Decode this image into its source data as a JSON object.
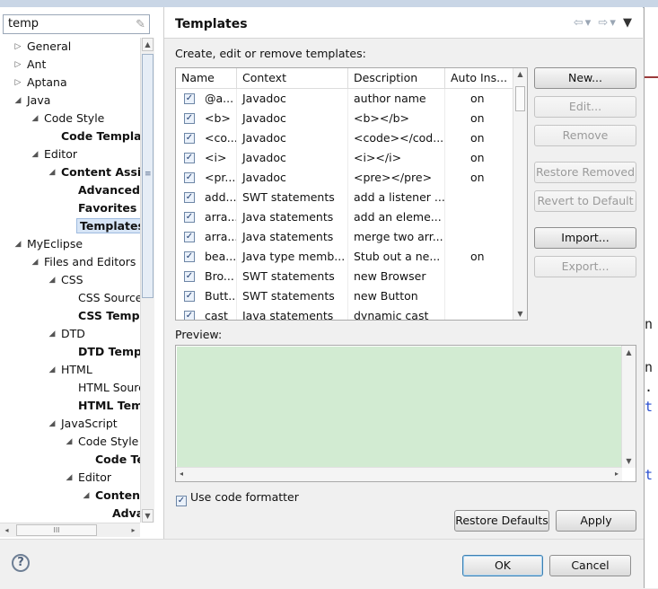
{
  "filter": {
    "value": "temp",
    "clear_icon": "eraser-icon"
  },
  "tree": [
    {
      "label": "General",
      "indent": 0,
      "arrow": "▷",
      "bold": false,
      "selected": false
    },
    {
      "label": "Ant",
      "indent": 0,
      "arrow": "▷",
      "bold": false,
      "selected": false
    },
    {
      "label": "Aptana",
      "indent": 0,
      "arrow": "▷",
      "bold": false,
      "selected": false
    },
    {
      "label": "Java",
      "indent": 0,
      "arrow": "◢",
      "bold": false,
      "selected": false
    },
    {
      "label": "Code Style",
      "indent": 1,
      "arrow": "◢",
      "bold": false,
      "selected": false
    },
    {
      "label": "Code Templat",
      "indent": 2,
      "arrow": "",
      "bold": true,
      "selected": false
    },
    {
      "label": "Editor",
      "indent": 1,
      "arrow": "◢",
      "bold": false,
      "selected": false
    },
    {
      "label": "Content Assist",
      "indent": 2,
      "arrow": "◢",
      "bold": true,
      "selected": false
    },
    {
      "label": "Advanced",
      "indent": 3,
      "arrow": "",
      "bold": true,
      "selected": false
    },
    {
      "label": "Favorites",
      "indent": 3,
      "arrow": "",
      "bold": true,
      "selected": false
    },
    {
      "label": "Templates",
      "indent": 3,
      "arrow": "",
      "bold": true,
      "selected": true
    },
    {
      "label": "MyEclipse",
      "indent": 0,
      "arrow": "◢",
      "bold": false,
      "selected": false
    },
    {
      "label": "Files and Editors",
      "indent": 1,
      "arrow": "◢",
      "bold": false,
      "selected": false
    },
    {
      "label": "CSS",
      "indent": 2,
      "arrow": "◢",
      "bold": false,
      "selected": false
    },
    {
      "label": "CSS Source",
      "indent": 3,
      "arrow": "",
      "bold": false,
      "selected": false
    },
    {
      "label": "CSS Templa",
      "indent": 3,
      "arrow": "",
      "bold": true,
      "selected": false
    },
    {
      "label": "DTD",
      "indent": 2,
      "arrow": "◢",
      "bold": false,
      "selected": false
    },
    {
      "label": "DTD Temp",
      "indent": 3,
      "arrow": "",
      "bold": true,
      "selected": false
    },
    {
      "label": "HTML",
      "indent": 2,
      "arrow": "◢",
      "bold": false,
      "selected": false
    },
    {
      "label": "HTML Sourc",
      "indent": 3,
      "arrow": "",
      "bold": false,
      "selected": false
    },
    {
      "label": "HTML Tem",
      "indent": 3,
      "arrow": "",
      "bold": true,
      "selected": false
    },
    {
      "label": "JavaScript",
      "indent": 2,
      "arrow": "◢",
      "bold": false,
      "selected": false
    },
    {
      "label": "Code Style",
      "indent": 3,
      "arrow": "◢",
      "bold": false,
      "selected": false
    },
    {
      "label": "Code Te",
      "indent": 4,
      "arrow": "",
      "bold": true,
      "selected": false
    },
    {
      "label": "Editor",
      "indent": 3,
      "arrow": "◢",
      "bold": false,
      "selected": false
    },
    {
      "label": "Content",
      "indent": 4,
      "arrow": "◢",
      "bold": true,
      "selected": false
    },
    {
      "label": "Adva",
      "indent": 5,
      "arrow": "",
      "bold": true,
      "selected": false
    }
  ],
  "tree_scroll": {
    "up": "▲",
    "down": "▼",
    "grip": "≡",
    "left": "◂",
    "right": "▸",
    "hgrip": "III"
  },
  "header": {
    "title": "Templates",
    "nav_back": "⇦",
    "nav_fwd": "⇨",
    "dropdown": "▾",
    "menu": "▼"
  },
  "subtitle": "Create, edit or remove templates:",
  "table": {
    "columns": [
      "Name",
      "Context",
      "Description",
      "Auto Ins..."
    ],
    "rows": [
      {
        "checked": true,
        "name": "@a...",
        "context": "Javadoc",
        "description": "author name",
        "auto": "on"
      },
      {
        "checked": true,
        "name": "<b>",
        "context": "Javadoc",
        "description": "<b></b>",
        "auto": "on"
      },
      {
        "checked": true,
        "name": "<co...",
        "context": "Javadoc",
        "description": "<code></cod...",
        "auto": "on"
      },
      {
        "checked": true,
        "name": "<i>",
        "context": "Javadoc",
        "description": "<i></i>",
        "auto": "on"
      },
      {
        "checked": true,
        "name": "<pr...",
        "context": "Javadoc",
        "description": "<pre></pre>",
        "auto": "on"
      },
      {
        "checked": true,
        "name": "add...",
        "context": "SWT statements",
        "description": "add a listener ...",
        "auto": ""
      },
      {
        "checked": true,
        "name": "arra...",
        "context": "Java statements",
        "description": "add an eleme...",
        "auto": ""
      },
      {
        "checked": true,
        "name": "arra...",
        "context": "Java statements",
        "description": "merge two arr...",
        "auto": ""
      },
      {
        "checked": true,
        "name": "bea...",
        "context": "Java type memb...",
        "description": "Stub out a ne...",
        "auto": "on"
      },
      {
        "checked": true,
        "name": "Bro...",
        "context": "SWT statements",
        "description": "new Browser",
        "auto": ""
      },
      {
        "checked": true,
        "name": "Butt...",
        "context": "SWT statements",
        "description": "new Button",
        "auto": ""
      },
      {
        "checked": true,
        "name": "cast",
        "context": "Java statements",
        "description": "dynamic cast",
        "auto": ""
      }
    ],
    "check_glyph": "✓",
    "scroll_up": "▲",
    "scroll_down": "▼"
  },
  "buttons": {
    "new": "New...",
    "edit": "Edit...",
    "remove": "Remove",
    "restore_removed": "Restore Removed",
    "revert": "Revert to Default",
    "import": "Import...",
    "export": "Export...",
    "restore_defaults": "Restore Defaults",
    "apply": "Apply",
    "ok": "OK",
    "cancel": "Cancel"
  },
  "preview": {
    "label": "Preview:",
    "up": "▲",
    "down": "▼",
    "left": "◂",
    "right": "▸"
  },
  "formatter": {
    "label": "Use code formatter",
    "checked": true
  },
  "help": {
    "glyph": "?"
  },
  "editor_glyphs": [
    {
      "text": "n",
      "blue": false
    },
    {
      "text": "n",
      "blue": false
    },
    {
      "text": ".",
      "blue": false
    },
    {
      "text": "t",
      "blue": true
    },
    {
      "text": "t",
      "blue": true
    }
  ],
  "colors": {
    "preview_bg": "#d2ebd2",
    "selection_bg": "#d7e5f6",
    "ok_border": "#3c7fb1"
  }
}
